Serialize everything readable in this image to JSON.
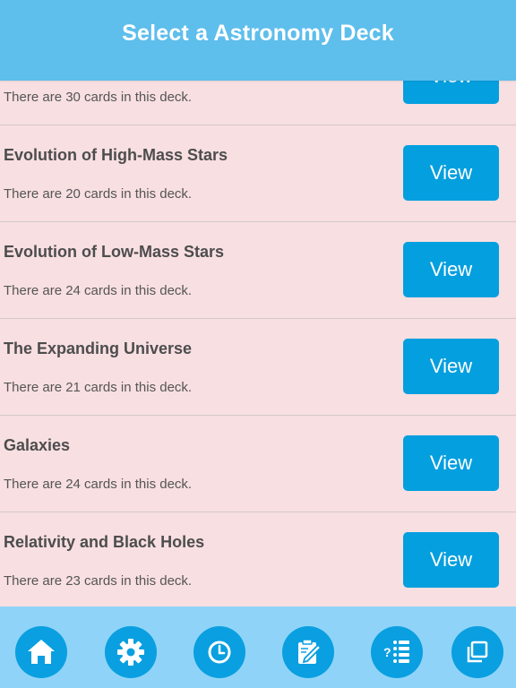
{
  "header": {
    "title": "Select a Astronomy Deck"
  },
  "decks": [
    {
      "title": "",
      "count_text": "There are 30 cards in this deck.",
      "button_label": "View"
    },
    {
      "title": "Evolution of High-Mass Stars",
      "count_text": "There are 20 cards in this deck.",
      "button_label": "View"
    },
    {
      "title": "Evolution of Low-Mass Stars",
      "count_text": "There are 24 cards in this deck.",
      "button_label": "View"
    },
    {
      "title": "The Expanding Universe",
      "count_text": "There are 21 cards in this deck.",
      "button_label": "View"
    },
    {
      "title": "Galaxies",
      "count_text": "There are 24 cards in this deck.",
      "button_label": "View"
    },
    {
      "title": "Relativity and Black Holes",
      "count_text": "There are 23 cards in this deck.",
      "button_label": "View"
    }
  ],
  "tabbar": {
    "icons": [
      "home-icon",
      "gear-icon",
      "clock-icon",
      "edit-note-icon",
      "quiz-list-icon",
      "copy-icon"
    ]
  },
  "colors": {
    "header_bg": "#5ebeec",
    "list_bg": "#f8dfe1",
    "button_bg": "#049fdf",
    "tabbar_bg": "#8fd4f8",
    "tab_circle": "#0a9fe0"
  }
}
